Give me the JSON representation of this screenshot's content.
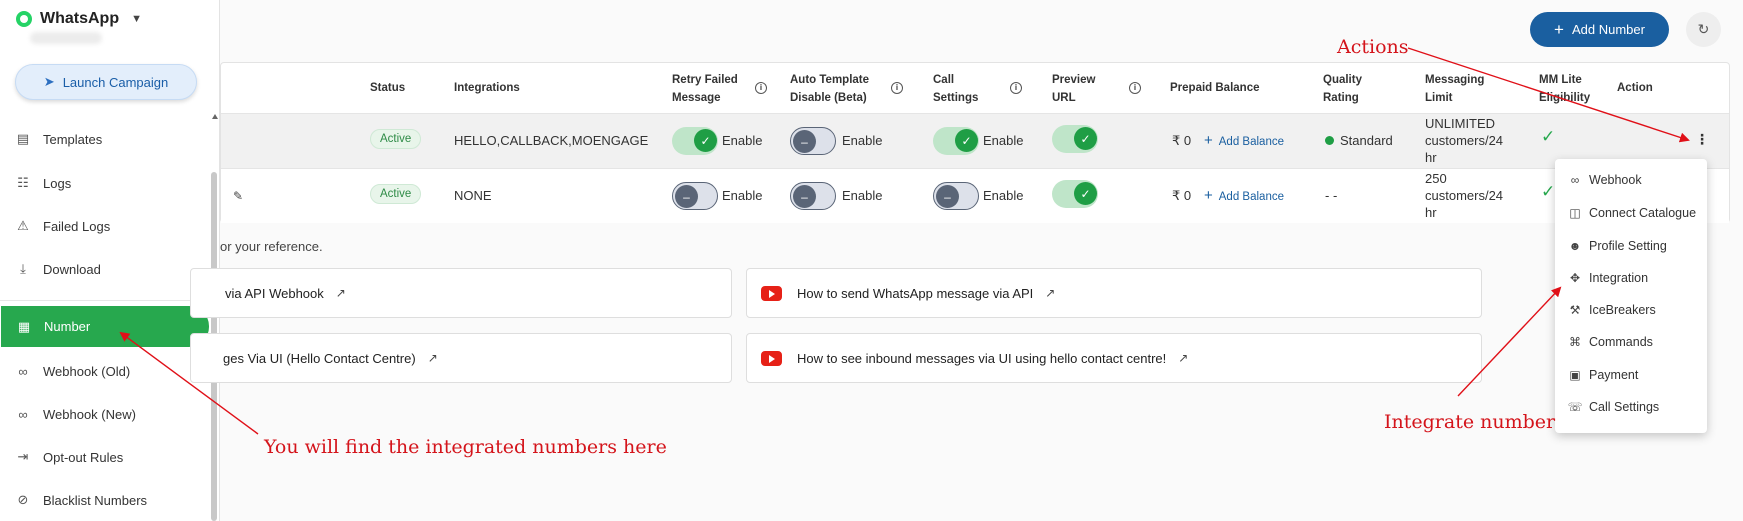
{
  "app": {
    "name": "WhatsApp"
  },
  "sidebar": {
    "launch_label": "Launch Campaign",
    "items": [
      {
        "label": "Templates",
        "icon": "template-icon"
      },
      {
        "label": "Logs",
        "icon": "document-icon"
      },
      {
        "label": "Failed Logs",
        "icon": "warning-icon"
      },
      {
        "label": "Download",
        "icon": "download-icon"
      },
      {
        "label": "Number",
        "icon": "dialpad-icon",
        "active": true
      },
      {
        "label": "Webhook (Old)",
        "icon": "webhook-icon"
      },
      {
        "label": "Webhook (New)",
        "icon": "webhook-icon"
      },
      {
        "label": "Opt-out Rules",
        "icon": "exit-icon"
      },
      {
        "label": "Blacklist Numbers",
        "icon": "block-icon"
      }
    ]
  },
  "toolbar": {
    "add_number_label": "Add Number"
  },
  "table": {
    "headers": {
      "status": "Status",
      "integrations": "Integrations",
      "retry_1": "Retry Failed",
      "retry_2": "Message",
      "auto_1": "Auto Template",
      "auto_2": "Disable (Beta)",
      "call_1": "Call",
      "call_2": "Settings",
      "preview_1": "Preview",
      "preview_2": "URL",
      "prepaid": "Prepaid Balance",
      "quality_1": "Quality",
      "quality_2": "Rating",
      "msg_1": "Messaging",
      "msg_2": "Limit",
      "mm_1": "MM Lite",
      "mm_2": "Eligibility",
      "action": "Action"
    },
    "rows": [
      {
        "status": "Active",
        "integrations": "HELLO,CALLBACK,MOENGAGE",
        "retry": "Enable",
        "retry_on": true,
        "auto": "Enable",
        "auto_on": false,
        "call": "Enable",
        "call_on": true,
        "preview_on": true,
        "balance": "₹ 0",
        "add_balance": "Add Balance",
        "quality": "Standard",
        "limit_1": "UNLIMITED",
        "limit_2": "customers/24",
        "limit_3": "hr"
      },
      {
        "status": "Active",
        "integrations": "NONE",
        "retry": "Enable",
        "retry_on": false,
        "auto": "Enable",
        "auto_on": false,
        "call": "Enable",
        "call_on": false,
        "preview_on": true,
        "balance": "₹ 0",
        "add_balance": "Add Balance",
        "quality": "- -",
        "limit_1": "250",
        "limit_2": "customers/24",
        "limit_3": "hr"
      }
    ]
  },
  "reference": {
    "intro": "or your reference.",
    "links": [
      "via API Webhook",
      "How to send WhatsApp message via API",
      "ges Via UI (Hello Contact Centre)",
      "How to see inbound messages via UI using hello contact centre!"
    ]
  },
  "menu": {
    "items": [
      {
        "label": "Webhook",
        "icon": "webhook-icon"
      },
      {
        "label": "Connect Catalogue",
        "icon": "catalogue-icon"
      },
      {
        "label": "Profile Setting",
        "icon": "profile-icon"
      },
      {
        "label": "Integration",
        "icon": "integration-icon"
      },
      {
        "label": "IceBreakers",
        "icon": "icebreaker-icon"
      },
      {
        "label": "Commands",
        "icon": "command-icon"
      },
      {
        "label": "Payment",
        "icon": "payment-icon"
      },
      {
        "label": "Call Settings",
        "icon": "phone-settings-icon"
      }
    ]
  },
  "annotations": {
    "actions": "Actions",
    "integrate": "Integrate number",
    "numbers_here": "You will find the integrated numbers here",
    "color": "#d4141b"
  },
  "colors": {
    "accent_green": "#27a84e",
    "brand_blue": "#1a5fa0"
  }
}
